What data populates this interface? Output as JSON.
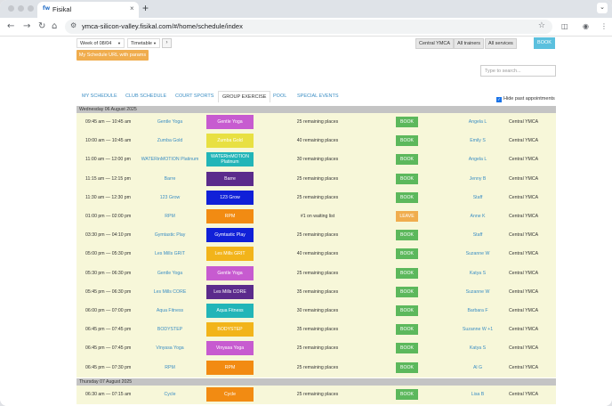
{
  "browser": {
    "tab_favicon": "fw",
    "tab_title": "Fisikal",
    "tab_close": "×",
    "new_tab": "+",
    "tab_menu": "⌄",
    "url": "ymca-silicon-valley.fisikal.com/#/home/schedule/index"
  },
  "toolbar": {
    "week_select": "Week of 08/04",
    "view_select": "Timetable",
    "next_arrow": "›",
    "location_filter": "Central YMCA",
    "trainer_filter": "All trainers",
    "service_filter": "All services",
    "book_label": "BOOK",
    "schedule_link_label": "My Schedule URL with params",
    "search_placeholder": "Type to search..."
  },
  "tabs": [
    {
      "label": "MY SCHEDULE"
    },
    {
      "label": "CLUB SCHEDULE"
    },
    {
      "label": "COURT SPORTS"
    },
    {
      "label": "GROUP EXERCISE"
    },
    {
      "label": "POOL"
    },
    {
      "label": "SPECIAL EVENTS"
    }
  ],
  "hide_past_label": "Hide past appointments",
  "days": [
    {
      "header": "Wednesday 06 August 2025",
      "rows": [
        {
          "time": "09:45 am — 10:45 am",
          "class": "Gentle Yoga",
          "color": "#c75bd0",
          "places": "25 remaining places",
          "action": "BOOK",
          "instructor": "Angela L",
          "location": "Central YMCA"
        },
        {
          "time": "10:00 am — 10:45 am",
          "class": "Zumba Gold",
          "color": "#e8e042",
          "places": "40 remaining places",
          "action": "BOOK",
          "instructor": "Emily S",
          "location": "Central YMCA"
        },
        {
          "time": "11:00 am — 12:00 pm",
          "class": "WATERinMOTION Platinum",
          "color": "#22b5b8",
          "places": "30 remaining places",
          "action": "BOOK",
          "instructor": "Angela L",
          "location": "Central YMCA"
        },
        {
          "time": "11:15 am — 12:15 pm",
          "class": "Barre",
          "color": "#5b2b8c",
          "places": "25 remaining places",
          "action": "BOOK",
          "instructor": "Jenny B",
          "location": "Central YMCA"
        },
        {
          "time": "11:30 am — 12:30 pm",
          "class": "123 Grow",
          "color": "#1020d8",
          "places": "25 remaining places",
          "action": "BOOK",
          "instructor": "Staff",
          "location": "Central YMCA"
        },
        {
          "time": "01:00 pm — 02:00 pm",
          "class": "RPM",
          "color": "#f28b12",
          "places": "#1 on waiting list",
          "action": "LEAVE",
          "instructor": "Anne K",
          "location": "Central YMCA"
        },
        {
          "time": "03:30 pm — 04:10 pm",
          "class": "Gymtastic Play",
          "color": "#1020d8",
          "places": "25 remaining places",
          "action": "BOOK",
          "instructor": "Staff",
          "location": "Central YMCA"
        },
        {
          "time": "05:00 pm — 05:30 pm",
          "class": "Les Mills GRIT",
          "color": "#f2b41a",
          "places": "40 remaining places",
          "action": "BOOK",
          "instructor": "Suzanne W",
          "location": "Central YMCA"
        },
        {
          "time": "05:30 pm — 06:30 pm",
          "class": "Gentle Yoga",
          "color": "#c75bd0",
          "places": "25 remaining places",
          "action": "BOOK",
          "instructor": "Katya S",
          "location": "Central YMCA"
        },
        {
          "time": "05:45 pm — 06:30 pm",
          "class": "Les Mills CORE",
          "color": "#5b2b8c",
          "places": "35 remaining places",
          "action": "BOOK",
          "instructor": "Suzanne W",
          "location": "Central YMCA"
        },
        {
          "time": "06:00 pm — 07:00 pm",
          "class": "Aqua Fitness",
          "color": "#22b5b8",
          "places": "30 remaining places",
          "action": "BOOK",
          "instructor": "Barbara F",
          "location": "Central YMCA"
        },
        {
          "time": "06:45 pm — 07:45 pm",
          "class": "BODYSTEP",
          "color": "#f2b41a",
          "places": "35 remaining places",
          "action": "BOOK",
          "instructor": "Suzanne W +1",
          "location": "Central YMCA"
        },
        {
          "time": "06:45 pm — 07:45 pm",
          "class": "Vinyasa Yoga",
          "color": "#c75bd0",
          "places": "25 remaining places",
          "action": "BOOK",
          "instructor": "Katya S",
          "location": "Central YMCA"
        },
        {
          "time": "06:45 pm — 07:30 pm",
          "class": "RPM",
          "color": "#f28b12",
          "places": "25 remaining places",
          "action": "BOOK",
          "instructor": "Al G",
          "location": "Central YMCA"
        }
      ]
    },
    {
      "header": "Thursday 07 August 2025",
      "rows": [
        {
          "time": "06:30 am — 07:15 am",
          "class": "Cycle",
          "color": "#f28b12",
          "places": "25 remaining places",
          "action": "BOOK",
          "instructor": "Lisa B",
          "location": "Central YMCA"
        }
      ]
    }
  ]
}
